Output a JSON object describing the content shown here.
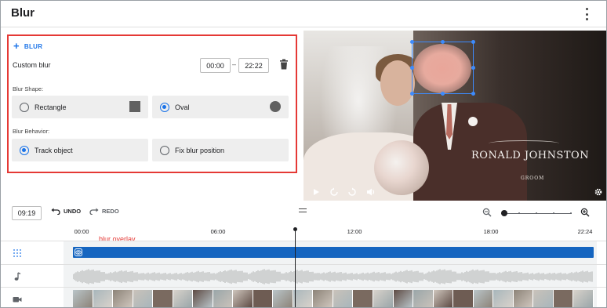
{
  "header": {
    "title": "Blur"
  },
  "panel": {
    "add_blur_label": "BLUR",
    "custom_blur_label": "Custom blur",
    "time_start": "00:00",
    "time_separator": "–",
    "time_end": "22:22",
    "blur_shape_label": "Blur Shape:",
    "shape_options": [
      {
        "label": "Rectangle",
        "selected": false,
        "swatch": "square-icon"
      },
      {
        "label": "Oval",
        "selected": true,
        "swatch": "circle-icon"
      }
    ],
    "blur_behavior_label": "Blur Behavior:",
    "behavior_options": [
      {
        "label": "Track object",
        "selected": true
      },
      {
        "label": "Fix blur position",
        "selected": false
      }
    ]
  },
  "video": {
    "overlay_name": "RONALD JOHNSTON",
    "overlay_role": "GROOM"
  },
  "timeline": {
    "current_time": "09:19",
    "undo_label": "UNDO",
    "redo_label": "REDO",
    "ruler_labels": [
      "00:00",
      "06:00",
      "12:00",
      "18:00",
      "22:24"
    ],
    "annotation": "blur overlay",
    "zoom_level_fraction": 0.0
  },
  "colors": {
    "accent": "#1a73e8",
    "highlight_border": "#e53935",
    "overlay_bar": "#1565c0"
  }
}
